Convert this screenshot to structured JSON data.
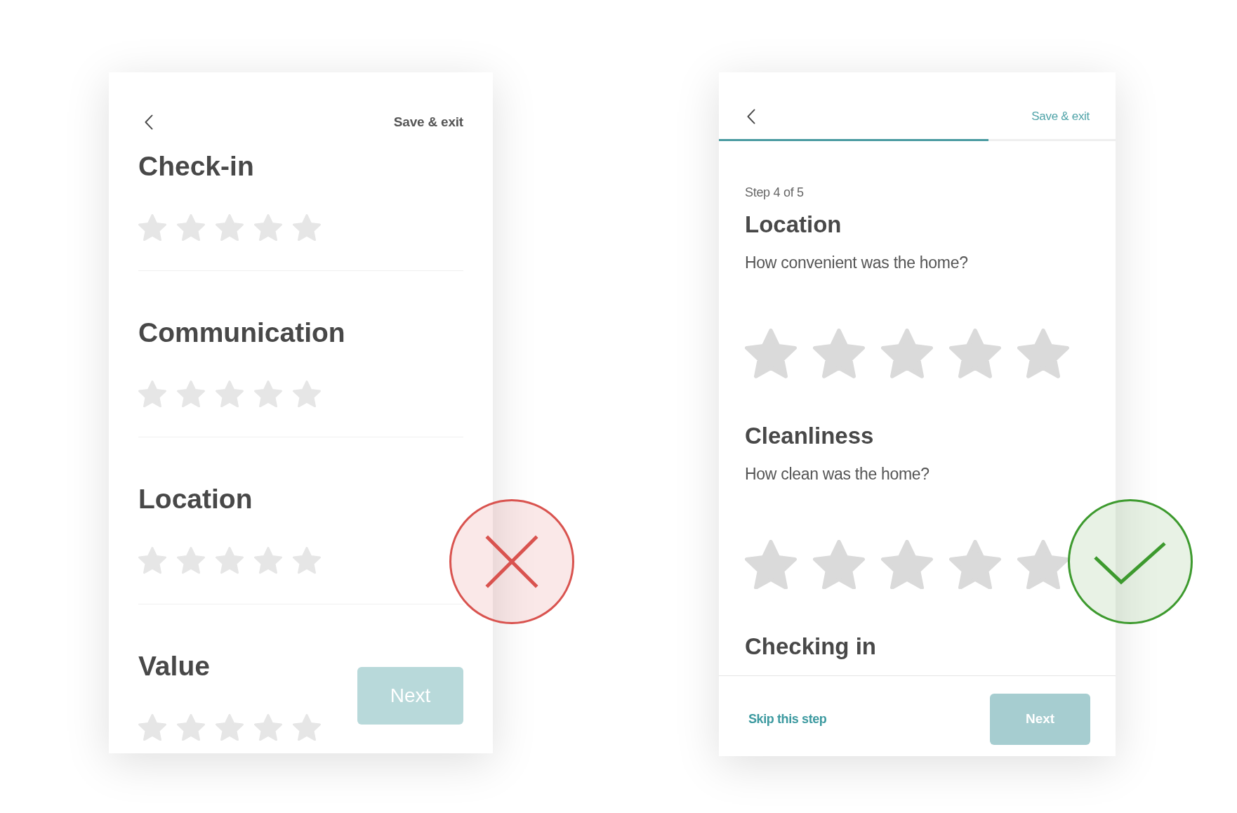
{
  "examples": [
    {
      "kind": "stacked",
      "badge": {
        "kind": "cross"
      },
      "save_exit": "Save & exit",
      "sections": [
        {
          "title": "Check-in",
          "stars": 0
        },
        {
          "title": "Communication",
          "stars": 0
        },
        {
          "title": "Location",
          "stars": 0
        },
        {
          "title": "Value",
          "stars": 0
        }
      ],
      "next_button": {
        "label": "Next",
        "disabled": true
      }
    },
    {
      "kind": "stepped",
      "badge": {
        "kind": "check"
      },
      "save_exit": "Save & exit",
      "progress": {
        "level": 0.68
      },
      "step": "Step 4 of 5",
      "sections": [
        {
          "title": "Location",
          "question": "How convenient was the home?",
          "stars": 0
        },
        {
          "title": "Cleanliness",
          "question": "How clean was the home?",
          "stars": 0
        },
        {
          "title": "Checking in"
        }
      ],
      "skip": "Skip this step",
      "next_button": {
        "label": "Next",
        "disabled": true
      }
    }
  ]
}
